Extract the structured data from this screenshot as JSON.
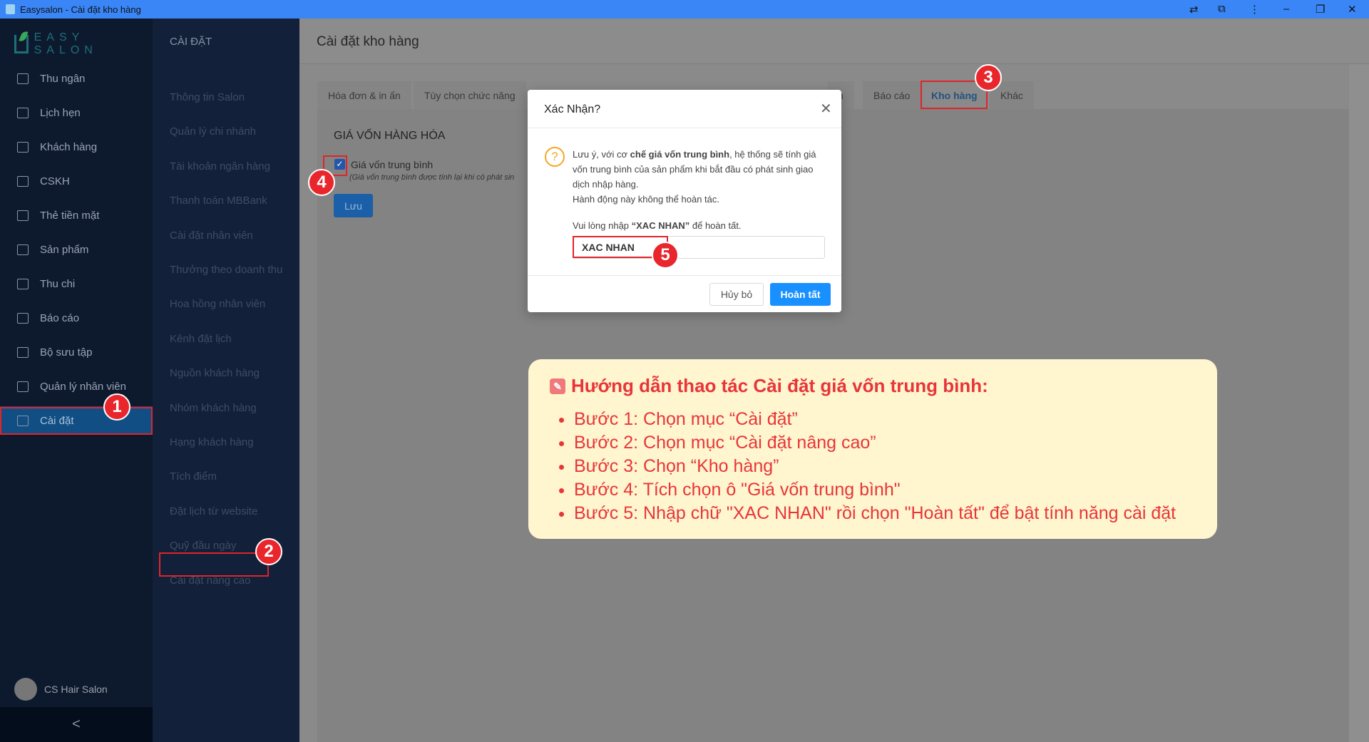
{
  "window": {
    "title": "Easysalon - Cài đặt kho hàng",
    "icons": [
      "translate-icon",
      "extension-icon",
      "more-icon",
      "minimize-icon",
      "restore-icon",
      "close-icon"
    ]
  },
  "logo": "EASY SALON",
  "sidebar": {
    "items": [
      {
        "label": "Thu ngân",
        "icon": "cashier-icon"
      },
      {
        "label": "Lịch hẹn",
        "icon": "calendar-icon"
      },
      {
        "label": "Khách hàng",
        "icon": "customers-icon"
      },
      {
        "label": "CSKH",
        "icon": "customer-care-icon"
      },
      {
        "label": "Thẻ tiền mặt",
        "icon": "card-icon"
      },
      {
        "label": "Sản phẩm",
        "icon": "product-icon"
      },
      {
        "label": "Thu chi",
        "icon": "ledger-icon"
      },
      {
        "label": "Báo cáo",
        "icon": "chart-icon"
      },
      {
        "label": "Bộ sưu tập",
        "icon": "gallery-icon"
      },
      {
        "label": "Quản lý nhân viên",
        "icon": "staff-icon"
      },
      {
        "label": "Cài đặt",
        "icon": "gear-icon",
        "active": true
      }
    ],
    "user": "CS Hair Salon",
    "collapse": "<"
  },
  "settings_menu": {
    "title": "CÀI ĐẶT",
    "items": [
      "Thông tin Salon",
      "Quản lý chi nhánh",
      "Tài khoản ngân hàng",
      "Thanh toán MBBank",
      "Cài đặt nhân viên",
      "Thưởng theo doanh thu",
      "Hoa hồng nhân viên",
      "Kênh đặt lịch",
      "Nguồn khách hàng",
      "Nhóm khách hàng",
      "Hạng khách hàng",
      "Tích điểm",
      "Đặt lịch từ website",
      "Quỹ đầu ngày",
      "Cài đặt nâng cao"
    ]
  },
  "header": {
    "title": "Cài đặt kho hàng"
  },
  "tabs": [
    {
      "label": "Hóa đơn & in ấn"
    },
    {
      "label": "Tùy chọn chức năng"
    },
    {
      "label": "n"
    },
    {
      "label": "Báo cáo"
    },
    {
      "label": "Kho hàng",
      "active": true
    },
    {
      "label": "Khác"
    }
  ],
  "section": {
    "title": "GIÁ VỐN HÀNG HÓA",
    "checkbox_label": "Giá vốn trung bình",
    "checked": true,
    "note": "(Giá vốn trung bình được tính lại khi có phát sin",
    "save": "Lưu"
  },
  "modal": {
    "title": "Xác Nhận?",
    "msg_pre": "Lưu ý, với cơ ",
    "msg_bold": "chế giá vốn trung bình",
    "msg_post": ", hệ thống sẽ tính giá vốn trung bình của sản phẩm khi bắt đầu có phát sinh giao dịch nhập hàng.",
    "msg_line2": "Hành động này không thể hoàn tác.",
    "prompt_pre": "Vui lòng nhập ",
    "prompt_bold": "“XAC NHAN”",
    "prompt_post": " để hoàn tất.",
    "input_value": "XAC NHAN",
    "cancel": "Hủy bỏ",
    "ok": "Hoàn tất"
  },
  "badges": [
    "1",
    "2",
    "3",
    "4",
    "5"
  ],
  "guide": {
    "title": "Hướng dẫn thao tác Cài đặt giá vốn trung bình:",
    "steps": [
      "Bước 1: Chọn mục “Cài đặt”",
      "Bước 2: Chọn mục “Cài đặt nâng cao”",
      "Bước 3: Chọn “Kho hàng”",
      "Bước 4: Tích chọn ô \"Giá vốn trung bình\"",
      "Bước 5: Nhập chữ \"XAC NHAN\" rồi chọn \"Hoàn tất\" để bật tính năng cài đặt"
    ]
  },
  "colors": {
    "accent": "#1890ff",
    "annotation": "#e8262c",
    "guide_bg": "#fff6cf"
  }
}
